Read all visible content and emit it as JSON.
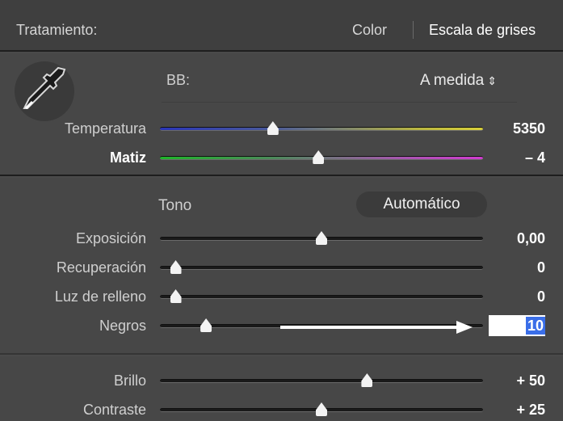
{
  "header": {
    "title": "Tratamiento:",
    "option_color": "Color",
    "option_grayscale": "Escala de grises"
  },
  "white_balance": {
    "label": "BB:",
    "value": "A medida",
    "value_arrows": "⇕"
  },
  "wb_sliders": [
    {
      "label": "Temperatura",
      "value": "5350",
      "position": 0.34
    },
    {
      "label": "Matiz",
      "value": "– 4",
      "position": 0.49
    }
  ],
  "tone": {
    "label": "Tono",
    "auto_button": "Automático"
  },
  "tone_sliders": [
    {
      "label": "Exposición",
      "value": "0,00",
      "position": 0.5
    },
    {
      "label": "Recuperación",
      "value": "0",
      "position": 0.02
    },
    {
      "label": "Luz de relleno",
      "value": "0",
      "position": 0.02
    },
    {
      "label": "Negros",
      "value": "10",
      "position": 0.12
    }
  ],
  "presence_sliders": [
    {
      "label": "Brillo",
      "value": "+ 50",
      "position": 0.65
    },
    {
      "label": "Contraste",
      "value": "+ 25",
      "position": 0.5
    }
  ],
  "colors": {
    "panel": "#474747",
    "header": "#3f3f3f",
    "selection": "#3a6ee8"
  }
}
